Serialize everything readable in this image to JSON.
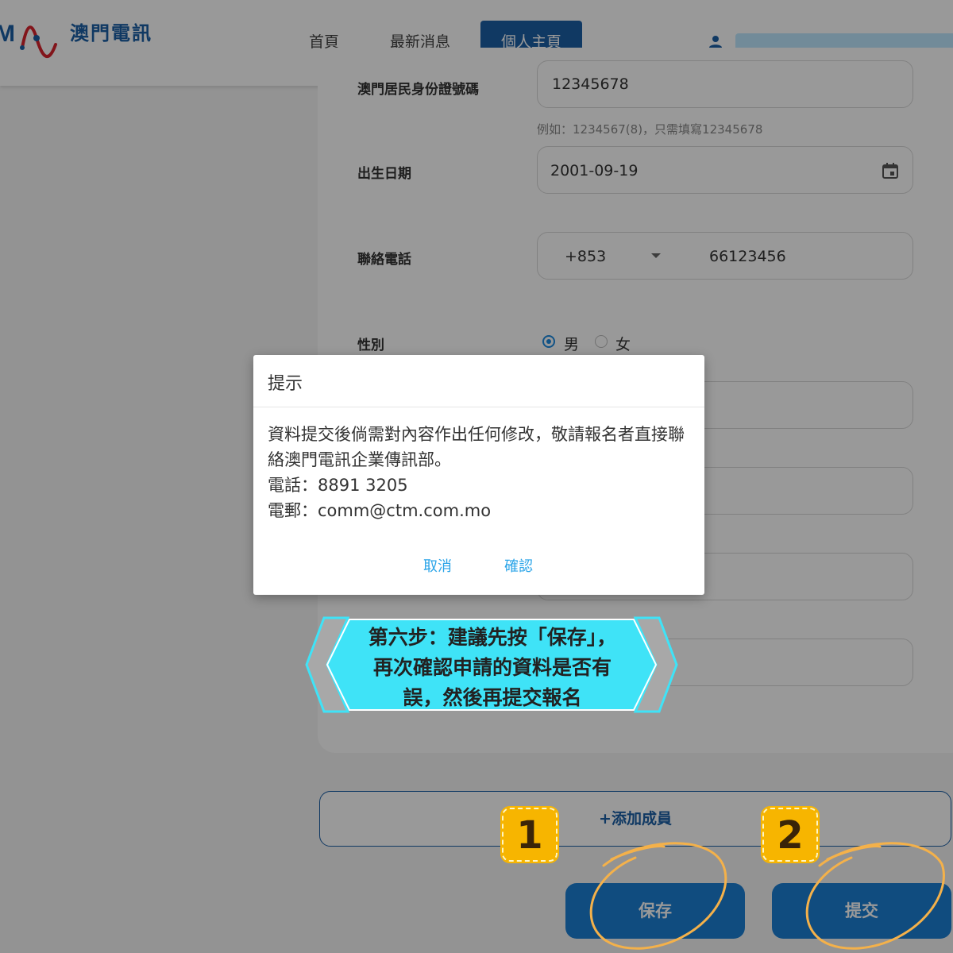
{
  "header": {
    "logo_mark_text": "M",
    "logo_text": "澳門電訊",
    "nav": [
      {
        "label": "首頁",
        "active": false
      },
      {
        "label": "最新消息",
        "active": false
      },
      {
        "label": "個人主頁",
        "active": true
      }
    ],
    "user_icon": "user-icon",
    "brand_color": "#1c5fa6"
  },
  "form": {
    "id_label": "澳門居民身份證號碼",
    "id_value": "12345678",
    "id_hint": "例如：1234567(8)，只需填寫12345678",
    "dob_label": "出生日期",
    "dob_value": "2001-09-19",
    "calendar_icon": "calendar-icon",
    "phone_label": "聯絡電話",
    "phone_code": "+853",
    "phone_value": "66123456",
    "gender_label": "性別",
    "gender_options": [
      {
        "label": "男",
        "checked": true
      },
      {
        "label": "女",
        "checked": false
      }
    ]
  },
  "actions": {
    "add_member": "+添加成員",
    "save": "保存",
    "submit": "提交"
  },
  "dialog": {
    "title": "提示",
    "body_line1": "資料提交後倘需對內容作出任何修改，敬請報名者直接聯絡澳門電訊企業傳訊部。",
    "body_phone": "電話：8891 3205",
    "body_email": "電郵：comm@ctm.com.mo",
    "cancel": "取消",
    "confirm": "確認",
    "link_color": "#2aa4e8"
  },
  "annotation": {
    "callout_line1": "第六步：建議先按「保存」，",
    "callout_line2": "再次確認申請的資料是否有",
    "callout_line3": "誤，然後再提交報名",
    "step1": "1",
    "step2": "2",
    "callout_color": "#3fe3f7",
    "badge_color": "#f7b500"
  }
}
